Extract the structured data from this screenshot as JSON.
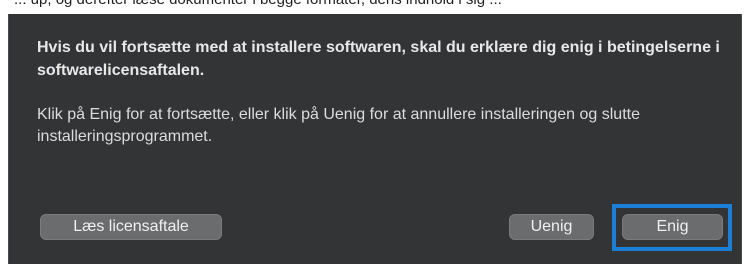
{
  "background_fragment": "... up, og derefter læse dokumenter i begge formater, dens indhold i sig ...",
  "dialog": {
    "headline": "Hvis du vil fortsætte med at installere softwaren, skal du erklære dig enig i betingelserne i softwarelicensaftalen.",
    "body": "Klik på Enig for at fortsætte, eller klik på Uenig for at annullere installeringen og slutte installeringsprogrammet.",
    "buttons": {
      "read_license": "Læs licensaftale",
      "disagree": "Uenig",
      "agree": "Enig"
    }
  },
  "colors": {
    "sheet_background": "#333436",
    "button_background": "#6b6c6e",
    "focus_highlight": "#1c7fd6"
  }
}
